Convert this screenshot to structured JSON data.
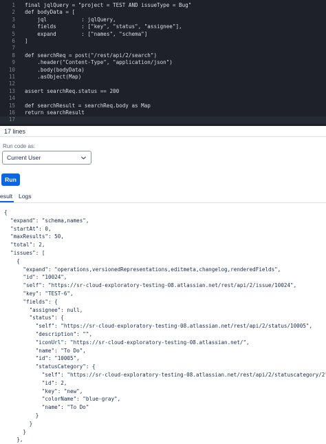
{
  "editor": {
    "lines": [
      {
        "num": "1",
        "code": "final jqlQuery = \"project = TEST AND issueType = Bug\""
      },
      {
        "num": "2",
        "code": "def bodyData = ["
      },
      {
        "num": "3",
        "code": "    jql           : jqlQuery,"
      },
      {
        "num": "4",
        "code": "    fields        : [\"key\", \"status\", \"assignee\"],"
      },
      {
        "num": "5",
        "code": "    expand        : [\"names\", \"schema\"]"
      },
      {
        "num": "6",
        "code": "]"
      },
      {
        "num": "7",
        "code": ""
      },
      {
        "num": "8",
        "code": "def searchReq = post(\"/rest/api/2/search\")"
      },
      {
        "num": "9",
        "code": "    .header(\"Content-Type\", \"application/json\")"
      },
      {
        "num": "10",
        "code": "    .body(bodyData)"
      },
      {
        "num": "11",
        "code": "    .asObject(Map)"
      },
      {
        "num": "12",
        "code": ""
      },
      {
        "num": "13",
        "code": "assert searchReq.status == 200"
      },
      {
        "num": "14",
        "code": ""
      },
      {
        "num": "15",
        "code": "def searchResult = searchReq.body as Map"
      },
      {
        "num": "16",
        "code": "return searchResult"
      },
      {
        "num": "17",
        "code": ""
      }
    ],
    "line_count": "17 lines"
  },
  "run_as": {
    "label": "Run code as:",
    "selected": "Current User"
  },
  "run_button": "Run",
  "tabs": {
    "result": "esult",
    "logs": "Logs"
  },
  "result_lines": [
    "{",
    "  \"expand\": \"schema,names\",",
    "  \"startAt\": 0,",
    "  \"maxResults\": 50,",
    "  \"total\": 2,",
    "  \"issues\": [",
    "    {",
    "      \"expand\": \"operations,versionedRepresentations,editmeta,changelog,renderedFields\",",
    "      \"id\": \"10024\",",
    "      \"self\": \"https://sr-cloud-exploratory-testing-08.atlassian.net/rest/api/2/issue/10024\",",
    "      \"key\": \"TEST-6\",",
    "      \"fields\": {",
    "        \"assignee\": null,",
    "        \"status\": {",
    "          \"self\": \"https://sr-cloud-exploratory-testing-08.atlassian.net/rest/api/2/status/10005\",",
    "          \"description\": \"\",",
    "          \"iconUrl\": \"https://sr-cloud-exploratory-testing-08.atlassian.net/\",",
    "          \"name\": \"To Do\",",
    "          \"id\": \"10005\",",
    "          \"statusCategory\": {",
    "            \"self\": \"https://sr-cloud-exploratory-testing-08.atlassian.net/rest/api/2/statuscategory/2\",",
    "            \"id\": 2,",
    "            \"key\": \"new\",",
    "            \"colorName\": \"blue-gray\",",
    "            \"name\": \"To Do\"",
    "          }",
    "        }",
    "      }",
    "    },"
  ]
}
